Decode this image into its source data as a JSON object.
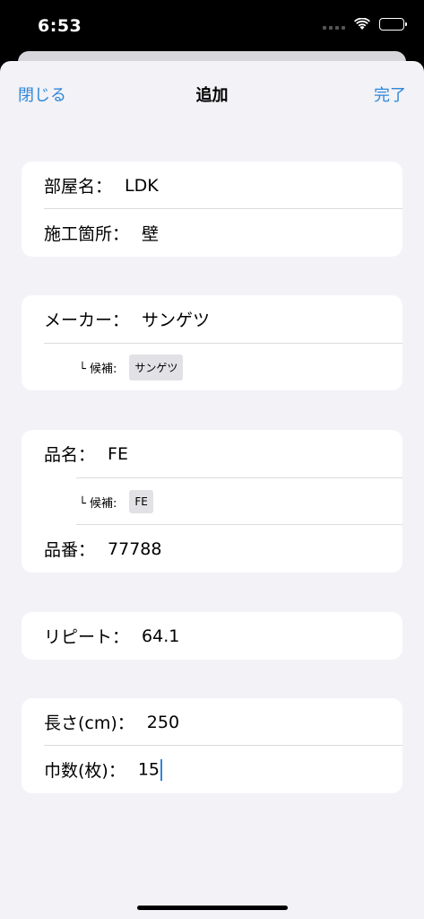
{
  "status": {
    "time": "6:53"
  },
  "nav": {
    "close": "閉じる",
    "title": "追加",
    "done": "完了"
  },
  "room": {
    "label": "部屋名：",
    "value": "LDK"
  },
  "location": {
    "label": "施工箇所：",
    "value": "壁"
  },
  "maker": {
    "label": "メーカー：",
    "value": "サンゲツ",
    "candidate_label": "└ 候補:",
    "candidate": "サンゲツ"
  },
  "product_name": {
    "label": "品名：",
    "value": "FE",
    "candidate_label": "└ 候補:",
    "candidate": "FE"
  },
  "product_number": {
    "label": "品番：",
    "value": "77788"
  },
  "repeat": {
    "label": "リピート：",
    "value": "64.1"
  },
  "length": {
    "label": "長さ(cm)：",
    "value": "250"
  },
  "widths": {
    "label": "巾数(枚)：",
    "value": "15"
  }
}
